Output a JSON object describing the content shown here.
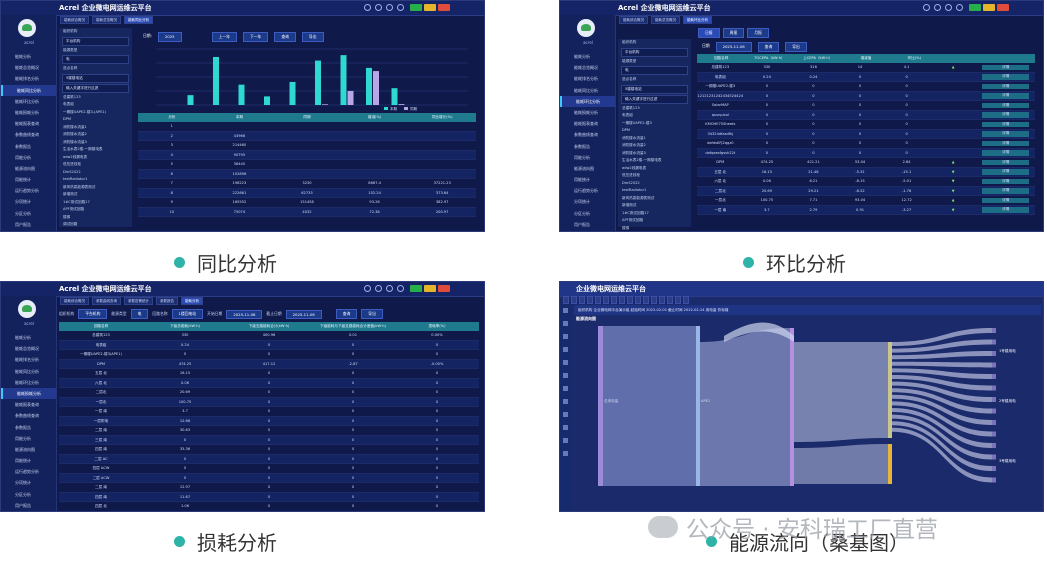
{
  "brand": {
    "logo_text": "Acrel",
    "platform_title": "企业微电网运维云平台",
    "logo_caption": "acrel"
  },
  "sidebar_items": [
    "能耗分析",
    "能耗总览概况",
    "能耗排名分析",
    "能耗同比分析",
    "能耗环比分析",
    "能耗损耗分析",
    "能耗报表查询",
    "参数曲线查询",
    "参数报告",
    "用能分析",
    "能源流向图",
    "用能统计",
    "运行趋势分析",
    "分项统计",
    "分区分析",
    "用户报告",
    "日常巡检",
    "环境监测"
  ],
  "panels": {
    "yoy": {
      "caption": "同比分析",
      "tabs": [
        "能耗综合概况",
        "能耗总览概况",
        "能耗同比分析"
      ],
      "tree_rows": [
        "组织机构",
        "平台机构",
        "能源类型",
        "电",
        "选点名称",
        "5楼楼电站",
        "输入关键字进行过滤",
        "总建筑123",
        "电表组",
        "一期楼UAPE2-楼3-(APE1)",
        "DPM",
        "消防楼水流量1",
        "消防楼水流量2",
        "消防楼水流量3",
        "生活水表2楼-一期楼电表",
        "adw2线漏电表",
        "低压进线柜",
        "DmS2022",
        "testRadiator1",
        "新风热泵能源表测试",
        "新增测试",
        "1#C测试回路17",
        "APF测试回路",
        "楼梯",
        "调试回路"
      ],
      "date_label": "日期:",
      "date_value": "2025",
      "btn_prev": "上一年",
      "btn_next": "下一年",
      "btn_query": "查询",
      "btn_export": "导出",
      "legend_current": "本期",
      "legend_prior": "同期",
      "table_headers": [
        "月份",
        "本期",
        "同期",
        "增减(%)",
        "同比增长(%)"
      ],
      "table_rows": [
        [
          "1",
          "",
          "",
          "",
          ""
        ],
        [
          "2",
          "43966",
          "",
          "",
          ""
        ],
        [
          "3",
          "214460",
          "",
          "",
          ""
        ],
        [
          "4",
          "90795",
          "",
          "",
          ""
        ],
        [
          "5",
          "38440",
          "",
          "",
          ""
        ],
        [
          "6",
          "102896",
          "",
          "",
          ""
        ],
        [
          "7",
          "198223",
          "3230",
          "8667.4",
          "37221.23"
        ],
        [
          "8",
          "222661",
          "62733",
          "152.24",
          "373.64"
        ],
        [
          "9",
          "165552",
          "151458",
          "93.26",
          "382.97"
        ],
        [
          "10",
          "75074",
          "4032",
          "72.38",
          "200.97"
        ]
      ]
    },
    "mom": {
      "caption": "环比分析",
      "tabs": [
        "能耗综合概况",
        "能耗总览概况",
        "能耗环比分析"
      ],
      "sub_tabs": [
        "日报",
        "周报",
        "月报"
      ],
      "date_label": "日期",
      "date_value": "2025-11-06",
      "btn_query": "查询",
      "btn_export": "导出",
      "table_headers": [
        "回路名称",
        "TOCEPA（kW·h）",
        "上CEPA（kW·h）",
        "增减值",
        "环比(%)",
        "",
        ""
      ],
      "table_rows": [
        [
          "总建筑123",
          "330",
          "316",
          "14",
          "4.1",
          "▲",
          "详情"
        ],
        [
          "电表组",
          "0.24",
          "0.24",
          "0",
          "0",
          "",
          "详情"
        ],
        [
          "一期楼UAPE2-楼3",
          "0",
          "0",
          "0",
          "0",
          "",
          "详情"
        ],
        [
          "12121231242434524424",
          "0",
          "0",
          "0",
          "0",
          "",
          "详情"
        ],
        [
          "SolarMAP",
          "0",
          "0",
          "0",
          "0",
          "",
          "详情"
        ],
        [
          "qsunpicol",
          "0",
          "0",
          "0",
          "0",
          "",
          "详情"
        ],
        [
          "KMOHE75Sheets",
          "0",
          "0",
          "0",
          "0",
          "",
          "详情"
        ],
        [
          "34324dfasdfkj",
          "0",
          "0",
          "0",
          "0",
          "",
          "详情"
        ],
        [
          "dafdsKFJ2qgz0",
          "0",
          "0",
          "0",
          "0",
          "",
          "详情"
        ],
        [
          "dafqaesfgssh22t",
          "0",
          "0",
          "0",
          "0",
          "",
          "详情"
        ],
        [
          "DPM",
          "474.25",
          "421.21",
          "53.04",
          "2.84",
          "▲",
          "详情"
        ],
        [
          "五层 北",
          "16.15",
          "21.46",
          "-5.31",
          "-15.1",
          "▼",
          "详情"
        ],
        [
          "六层 北",
          "0.06",
          "8.21",
          "-8.15",
          "-5.01",
          "▼",
          "详情"
        ],
        [
          "二层北",
          "20.69",
          "29.21",
          "-8.52",
          "-1.76",
          "▼",
          "详情"
        ],
        [
          "一层北",
          "100.75",
          "7.71",
          "93.04",
          "12.72",
          "▲",
          "详情"
        ],
        [
          "一层 南",
          "3.7",
          "2.79",
          "0.91",
          "-3.27",
          "▼",
          "详情"
        ]
      ],
      "tree_rows": [
        "组织机构",
        "平台机构",
        "能源类型",
        "电",
        "选点名称",
        "5楼楼电站",
        "输入关键字进行过滤",
        "总建筑123",
        "电表组",
        "一期楼UAPE2-楼3",
        "DPM",
        "消防楼水流量1",
        "消防楼水流量2",
        "消防楼水流量3",
        "生活水表2楼-一期楼电表",
        "adw2线漏电表",
        "低压进线柜",
        "DmS2022",
        "testRadiator1",
        "新风热泵能源表测试",
        "新增测试",
        "1#C测试回路17",
        "APF测试回路",
        "楼梯"
      ]
    },
    "loss": {
      "caption": "损耗分析",
      "tabs": [
        "能耗综合概况",
        "参数曲线查询",
        "参数告警统计",
        "参数报告",
        "能耗分析"
      ],
      "filters": [
        "组织机构",
        "平台机构",
        "能源类型",
        "电",
        "回路名称",
        "1楼回电站",
        "开始日期",
        "2025-11-06",
        "截止日期",
        "2025-11-06"
      ],
      "btn_query": "查询",
      "btn_export": "导出",
      "table_headers": [
        "回路名称",
        "下级总能耗(kW·h)",
        "下级支路能耗合计(kW·h)",
        "下级能耗与下级支路能耗合计差值(kW·h)",
        "损耗率(%)"
      ],
      "table_rows": [
        [
          "总建筑123",
          "330",
          "400.96",
          "0.01",
          "0.00%"
        ],
        [
          "电表组",
          "0.24",
          "0",
          "0",
          "0"
        ],
        [
          "一期楼UAPE2-楼3(APE1)",
          "0",
          "0",
          "0",
          "0"
        ],
        [
          "DPM",
          "474.25",
          "417.12",
          "-2.87",
          "-0.00%"
        ],
        [
          "五层 北",
          "16.15",
          "0",
          "0",
          "0"
        ],
        [
          "六层 北",
          "0.06",
          "0",
          "0",
          "0"
        ],
        [
          "二层北",
          "20.69",
          "0",
          "0",
          "0"
        ],
        [
          "一层北",
          "100.75",
          "0",
          "0",
          "0"
        ],
        [
          "一层 南",
          "3.7",
          "0",
          "0",
          "0"
        ],
        [
          "一层附电",
          "12.66",
          "0",
          "0",
          "0"
        ],
        [
          "二层 南",
          "30.63",
          "0",
          "0",
          "0"
        ],
        [
          "三层 南",
          "0",
          "0",
          "0",
          "0"
        ],
        [
          "四层 南",
          "33.36",
          "0",
          "0",
          "0"
        ],
        [
          "二层 AC",
          "0",
          "0",
          "0",
          "0"
        ],
        [
          "四层 ACW",
          "0",
          "0",
          "0",
          "0"
        ],
        [
          "二层 ACW",
          "0",
          "0",
          "0",
          "0"
        ],
        [
          "二层 南",
          "12.97",
          "0",
          "0",
          "0"
        ],
        [
          "四层 南",
          "11.67",
          "0",
          "0",
          "0"
        ],
        [
          "四层 北",
          "1.06",
          "0",
          "0",
          "0"
        ]
      ]
    },
    "sankey": {
      "caption": "能源流向（桑基图）",
      "filter_text": "组织机构  企业微电网平台演示组  起始时间  2022-02-01  截止时间  2022-02-24  用电量  折标煤",
      "title": "能源流向图",
      "left_label": "总用电量",
      "mid_label": "APE1",
      "right_labels": [
        "1号楼用电",
        "2号楼用电",
        "3号楼用电"
      ]
    }
  },
  "watermark": "公众号 · 安科瑞工厂直营"
}
